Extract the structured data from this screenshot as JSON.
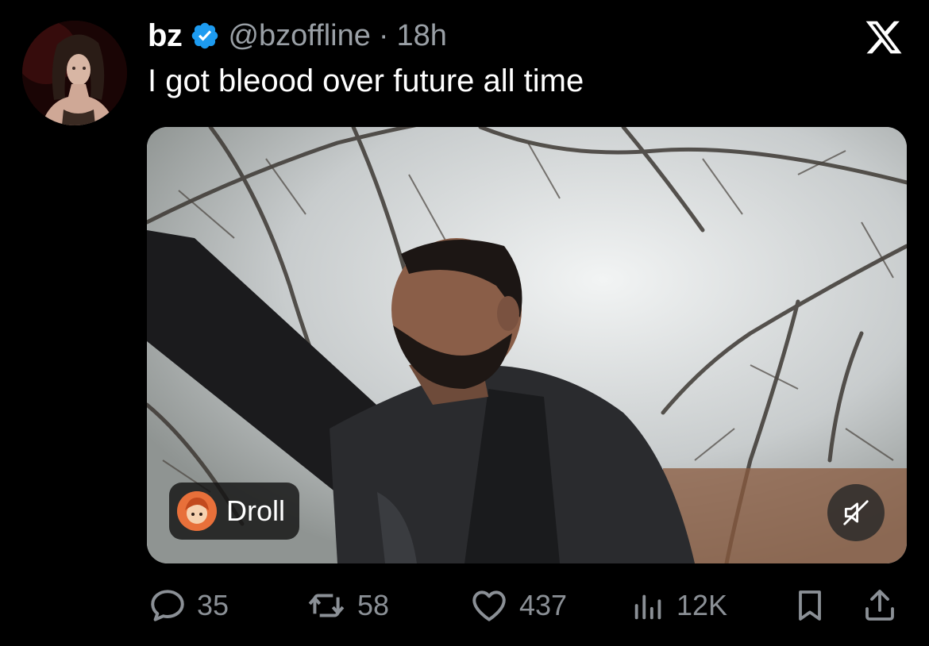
{
  "tweet": {
    "display_name": "bz",
    "handle": "@bzoffline",
    "separator": "·",
    "time": "18h",
    "text": "I got bleood over future all time"
  },
  "media": {
    "source_label": "Droll"
  },
  "actions": {
    "replies": "35",
    "reposts": "58",
    "likes": "437",
    "views": "12K"
  },
  "icons": {
    "verified": "verified-badge-icon",
    "logo": "x-logo-icon",
    "reply": "reply-icon",
    "repost": "repost-icon",
    "like": "heart-icon",
    "views": "views-icon",
    "bookmark": "bookmark-icon",
    "share": "share-icon",
    "mute": "muted-speaker-icon"
  },
  "colors": {
    "background": "#000000",
    "verified": "#1d9bf0",
    "muted_text": "#8b9096"
  }
}
